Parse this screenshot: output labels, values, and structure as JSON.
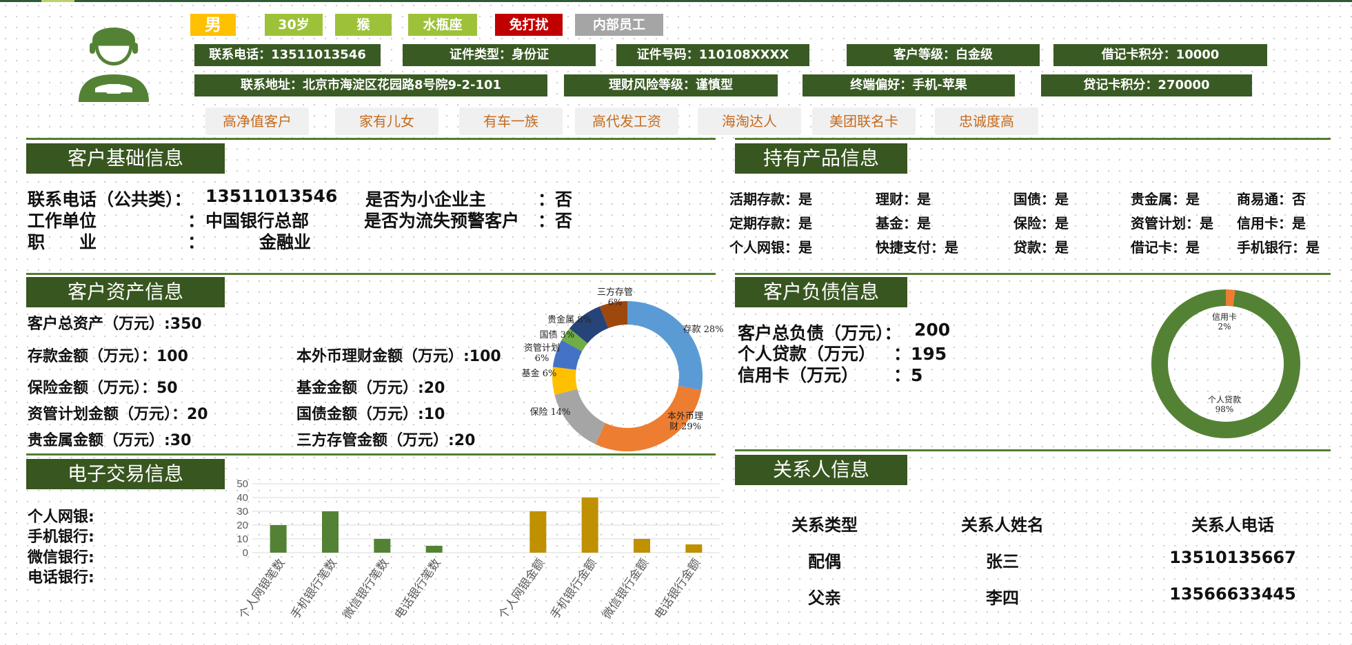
{
  "profile": {
    "tags": [
      {
        "text": "男",
        "bg": "#ffc000"
      },
      {
        "text": "30岁",
        "bg": "#9dc23a"
      },
      {
        "text": "猴",
        "bg": "#9dc23a"
      },
      {
        "text": "水瓶座",
        "bg": "#9dc23a"
      },
      {
        "text": "免打扰",
        "bg": "#c00000"
      },
      {
        "text": "内部员工",
        "bg": "#a5a5a5"
      }
    ],
    "row1": [
      "联系电话：13511013546",
      "证件类型：身份证",
      "证件号码：110108XXXX",
      "客户等级：白金级",
      "借记卡积分：10000"
    ],
    "row2": [
      "联系地址：北京市海淀区花园路8号院9-2-101",
      "理财风险等级：谨慎型",
      "终端偏好：手机-苹果",
      "贷记卡积分：270000"
    ],
    "labels": [
      "高净值客户",
      "家有儿女",
      "有车一族",
      "高代发工资",
      "海淘达人",
      "美团联名卡",
      "忠诚度高"
    ]
  },
  "basic": {
    "title": "客户基础信息",
    "phone_label": "联系电话（公共类）：",
    "phone": "13511013546",
    "work_label": "工作单位",
    "work_colon": "：",
    "work": "中国银行总部",
    "job_label": "职　　业",
    "job_colon": "：",
    "job": "金融业",
    "owner_label": "是否为小企业主",
    "owner_value": "：否",
    "churn_label": "是否为流失预警客户",
    "churn_value": "：否"
  },
  "products": {
    "title": "持有产品信息",
    "rows": [
      [
        "活期存款：是",
        "理财：是",
        "国债：是",
        "贵金属：是",
        "商易通：否"
      ],
      [
        "定期存款：是",
        "基金：是",
        "保险：是",
        "资管计划：是",
        "信用卡：是"
      ],
      [
        "个人网银：是",
        "快捷支付：是",
        "贷款：是",
        "借记卡：是",
        "手机银行：是"
      ]
    ]
  },
  "assets": {
    "title": "客户资产信息",
    "total": "客户总资产（万元）:350",
    "deposit": "存款金额（万元）：100",
    "fx": "本外币理财金额（万元）:100",
    "insurance": "保险金额（万元）：50",
    "fund": "基金金额（万元）:20",
    "amp": "资管计划金额（万元）：20",
    "bond": "国债金额（万元）:10",
    "metal": "贵金属金额（万元）:30",
    "custody": "三方存管金额（万元）:20"
  },
  "debt": {
    "title": "客户负债信息",
    "total_label": "客户总负债（万元）：",
    "total": "200",
    "loan_label": "个人贷款（万元）",
    "loan": "：195",
    "card_label": "信用卡（万元）",
    "card": "：5"
  },
  "etrade": {
    "title": "电子交易信息",
    "items": [
      "个人网银:",
      "手机银行:",
      "微信银行:",
      "电话银行:"
    ]
  },
  "relations": {
    "title": "关系人信息",
    "headers": [
      "关系类型",
      "关系人姓名",
      "关系人电话"
    ],
    "rows": [
      [
        "配偶",
        "张三",
        "13510135667"
      ],
      [
        "父亲",
        "李四",
        "13566633445"
      ]
    ]
  },
  "chart_data": [
    {
      "type": "pie",
      "variant": "donut",
      "categories": [
        "存款",
        "本外币理财",
        "保险",
        "基金",
        "资管计划",
        "国债",
        "贵金属",
        "三方存管"
      ],
      "values": [
        28,
        29,
        14,
        6,
        6,
        3,
        8,
        6
      ],
      "labels": [
        "存款 28%",
        "本外币理财 29%",
        "保险 14%",
        "基金 6%",
        "资管计划 6%",
        "国债 3%",
        "贵金属 8%",
        "三方存管 6%"
      ],
      "colors": [
        "#5b9bd5",
        "#ed7d31",
        "#a5a5a5",
        "#ffc000",
        "#4472c4",
        "#70ad47",
        "#264478",
        "#9e480e"
      ]
    },
    {
      "type": "pie",
      "variant": "donut",
      "categories": [
        "信用卡",
        "个人贷款"
      ],
      "values": [
        2,
        98
      ],
      "labels": [
        "信用卡 2%",
        "个人贷款 98%"
      ],
      "colors": [
        "#ed7d31",
        "#548235"
      ]
    },
    {
      "type": "bar",
      "categories": [
        "个人网银笔数",
        "手机银行笔数",
        "微信银行笔数",
        "电话银行笔数",
        "",
        "个人网银金额",
        "手机银行金额",
        "微信银行金额",
        "电话银行金额"
      ],
      "values": [
        20,
        30,
        10,
        5,
        null,
        30,
        40,
        10,
        6
      ],
      "colors": [
        "#548235",
        "#548235",
        "#548235",
        "#548235",
        "#548235",
        "#bf9000",
        "#bf9000",
        "#bf9000",
        "#bf9000"
      ],
      "ylim": [
        0,
        50
      ],
      "yticks": [
        0,
        10,
        20,
        30,
        40,
        50
      ],
      "grid": true
    }
  ]
}
